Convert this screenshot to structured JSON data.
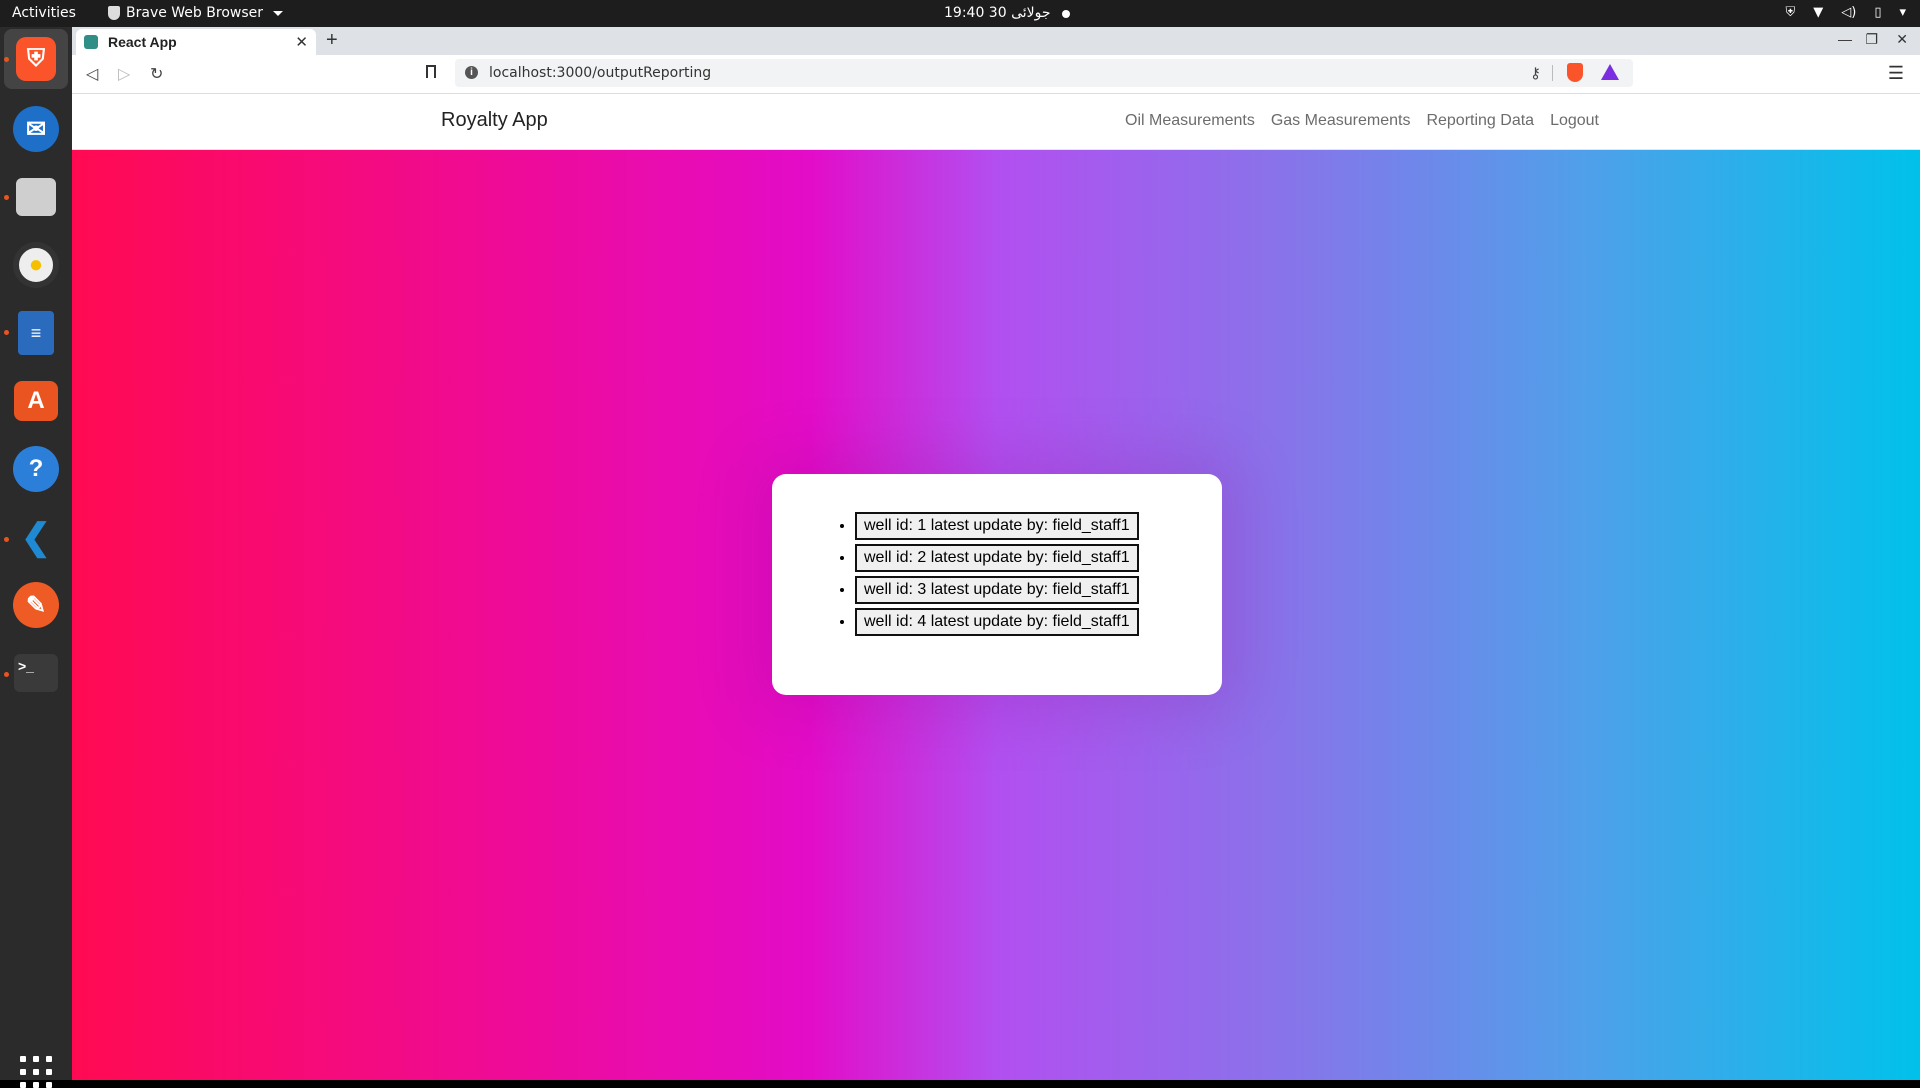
{
  "topbar": {
    "activities": "Activities",
    "app_name": "Brave Web Browser",
    "clock": "19:40  30 جولائی"
  },
  "dock": {
    "items": [
      "brave-browser",
      "thunderbird",
      "files",
      "rhythmbox",
      "libreoffice-writer",
      "ubuntu-software",
      "help",
      "vscode",
      "postman",
      "terminal"
    ]
  },
  "browser": {
    "tab_title": "React App",
    "url": "localhost:3000/outputReporting"
  },
  "app": {
    "brand": "Royalty App",
    "nav": [
      "Oil Measurements",
      "Gas Measurements",
      "Reporting Data",
      "Logout"
    ],
    "wells": [
      "well id: 1 latest update by: field_staff1",
      "well id: 2 latest update by: field_staff1",
      "well id: 3 latest update by: field_staff1",
      "well id: 4 latest update by: field_staff1"
    ]
  },
  "colors": {
    "gradient": [
      "#ff0a52",
      "#e30cc8",
      "#b24ff0",
      "#00c1ea"
    ],
    "ubuntu_orange": "#e95420"
  }
}
